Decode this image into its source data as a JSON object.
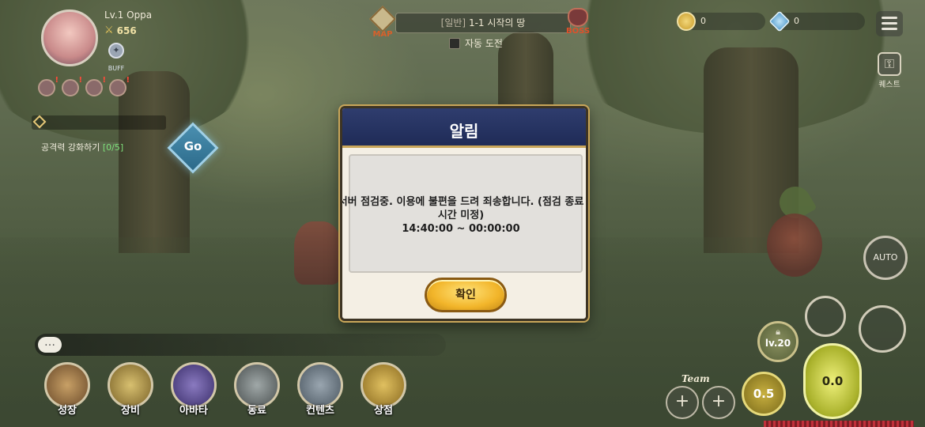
{
  "player": {
    "level_text": "Lv.1 Oppa",
    "power": "656",
    "buff_label": "BUFF"
  },
  "quest": {
    "text": "공격력 강화하기",
    "progress": "[0/5]",
    "go_label": "Go"
  },
  "stage": {
    "map_label": "MAP",
    "mode": "[일반]",
    "name": "1-1 시작의 땅",
    "boss_label": "BOSS",
    "auto_challenge_label": "자동 도전"
  },
  "currencies": {
    "gold": "0",
    "gem": "0"
  },
  "side": {
    "quest_label": "퀘스트",
    "auto_label": "AUTO"
  },
  "dialog": {
    "title": "알림",
    "message_line1": "서버 점검중. 이용에 불편을 드려 죄송합니다. (점검 종료",
    "message_line2": "시간 미정)",
    "message_line3": "14:40:00 ~ 00:00:00",
    "confirm_label": "확인"
  },
  "bottom_menu": {
    "items": [
      {
        "label": "성장"
      },
      {
        "label": "장비"
      },
      {
        "label": "아바타"
      },
      {
        "label": "동료"
      },
      {
        "label": "컨텐츠"
      },
      {
        "label": "상점"
      }
    ]
  },
  "controls": {
    "lv_label": "lv.20",
    "speed_label": "0.5",
    "main_skill_label": "0.0",
    "team_label": "Team",
    "plus": "+"
  },
  "colors": {
    "dialog_header": "#1f2b57",
    "confirm_button": "#f2b52a",
    "quest_progress": "#7ee07a",
    "boss_text": "#e0502a"
  }
}
